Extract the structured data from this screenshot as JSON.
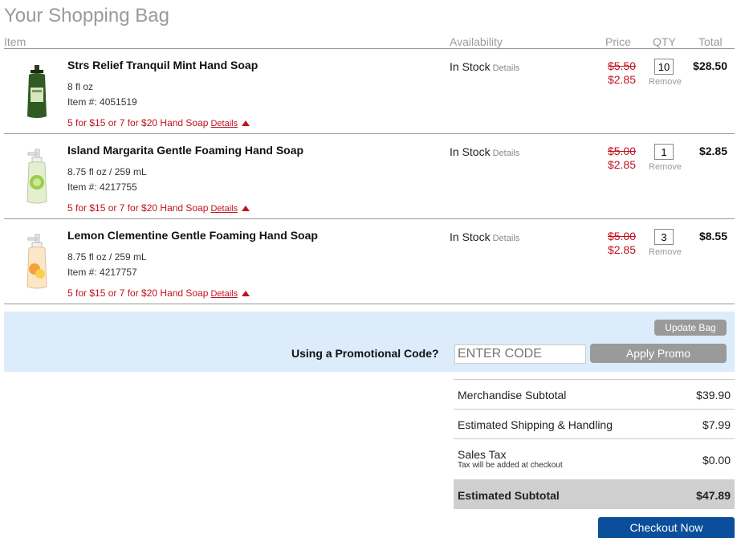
{
  "title": "Your Shopping Bag",
  "columns": {
    "item": "Item",
    "availability": "Availability",
    "price": "Price",
    "qty": "QTY",
    "total": "Total"
  },
  "items": [
    {
      "name": "Strs Relief Tranquil Mint Hand Soap",
      "size": "8 fl oz",
      "item_no": "Item #: 4051519",
      "promo": "5 for $15 or 7 for $20 Hand Soap",
      "promo_details": "Details",
      "availability": "In Stock",
      "availability_details": "Details",
      "was_price": "$5.50",
      "price": "$2.85",
      "qty": "10",
      "remove": "Remove",
      "total": "$28.50"
    },
    {
      "name": "Island Margarita Gentle Foaming Hand Soap",
      "size": "8.75 fl oz / 259 mL",
      "item_no": "Item #: 4217755",
      "promo": "5 for $15 or 7 for $20 Hand Soap",
      "promo_details": "Details",
      "availability": "In Stock",
      "availability_details": "Details",
      "was_price": "$5.00",
      "price": "$2.85",
      "qty": "1",
      "remove": "Remove",
      "total": "$2.85"
    },
    {
      "name": "Lemon Clementine Gentle Foaming Hand Soap",
      "size": "8.75 fl oz / 259 mL",
      "item_no": "Item #: 4217757",
      "promo": "5 for $15 or 7 for $20 Hand Soap",
      "promo_details": "Details",
      "availability": "In Stock",
      "availability_details": "Details",
      "was_price": "$5.00",
      "price": "$2.85",
      "qty": "3",
      "remove": "Remove",
      "total": "$8.55"
    }
  ],
  "promo_section": {
    "update_label": "Update Bag",
    "label": "Using a Promotional Code?",
    "placeholder": "ENTER CODE",
    "apply_label": "Apply Promo"
  },
  "summary": {
    "merchandise_label": "Merchandise Subtotal",
    "merchandise_value": "$39.90",
    "shipping_label": "Estimated Shipping & Handling",
    "shipping_value": "$7.99",
    "tax_label": "Sales Tax",
    "tax_note": "Tax will be added at checkout",
    "tax_value": "$0.00",
    "estimated_label": "Estimated Subtotal",
    "estimated_value": "$47.89"
  },
  "checkout_label": "Checkout Now",
  "colors": {
    "sale_red": "#c1121f",
    "promo_band": "#dcecfb",
    "checkout_blue": "#0b4f9c",
    "button_grey": "#9a9a9a"
  }
}
